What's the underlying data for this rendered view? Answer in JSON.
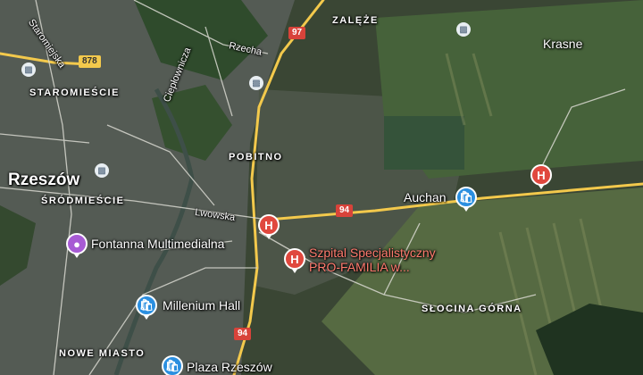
{
  "places": {
    "city": "Rzeszów",
    "districts": [
      "STAROMIEŚCIE",
      "ŚRÓDMIEŚCIE",
      "NOWE MIASTO",
      "POBITNO",
      "ZALĘŻE",
      "SŁOCINA GÓRNA"
    ],
    "town": "Krasne"
  },
  "streets": {
    "staromiejska": "Staromiejska",
    "rzecha": "Rzecha",
    "cieplownicza": "Ciepłownicza",
    "lwowska": "Lwowska"
  },
  "road_shields": {
    "r97": "97",
    "r878": "878",
    "r94_a": "94",
    "r94_b": "94"
  },
  "pois": {
    "auchan": "Auchan",
    "szpital_line1": "Szpital Specjalistyczny",
    "szpital_line2": "PRO-FAMILIA w...",
    "fontanna": "Fontanna Multimedialna",
    "millenium": "Millenium Hall",
    "plaza": "Plaza Rzeszów"
  },
  "icons": {
    "hospital": "hospital-icon",
    "shop": "shopping-bag-icon",
    "museum": "camera-icon",
    "transit": "bus-stop-icon"
  },
  "colors": {
    "main_road": "#f3c94c",
    "hospital_pin": "#e0483e",
    "shop_pin": "#2b8fe0",
    "museum_pin": "#a75bd4",
    "road_shield_red": "#d8433a"
  }
}
